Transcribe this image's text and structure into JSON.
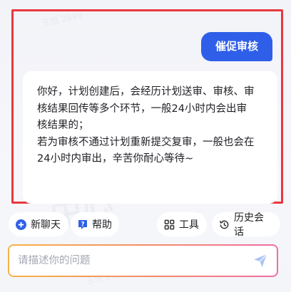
{
  "watermark": {
    "user": "王悦 2699",
    "center": "中心"
  },
  "chat": {
    "user_message": "催促审核",
    "bot_lines": [
      "你好，计划创建后，会经历计划送审、审核、审",
      "核结果回传等多个环节，一般24小时内会出审",
      "核结果的；",
      "若为审核不通过计划重新提交复审，一般也会在",
      "24小时内审出，辛苦你耐心等待~"
    ]
  },
  "toolbar": {
    "new_chat": "新聊天",
    "help": "帮助",
    "tools": "工具",
    "history": "历史会话"
  },
  "input": {
    "placeholder": "请描述你的问题"
  },
  "colors": {
    "accent_blue": "#2f5fe8",
    "highlight_red": "#e8373f"
  }
}
